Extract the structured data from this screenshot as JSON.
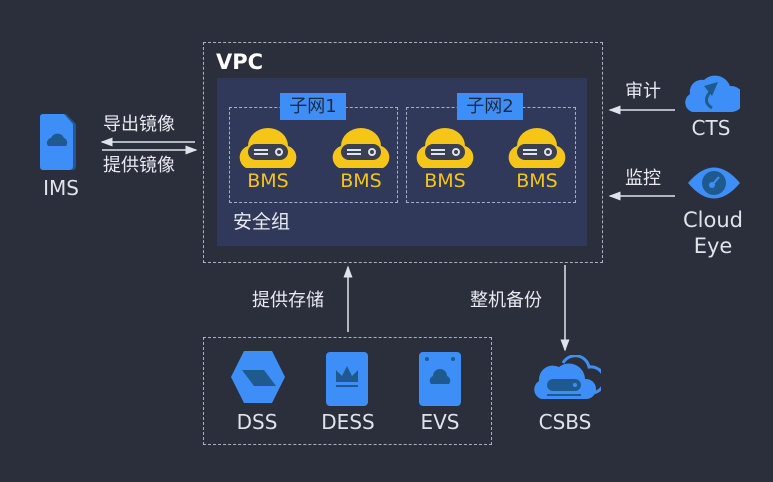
{
  "vpc": {
    "title": "VPC",
    "security_group": "安全组",
    "subnets": [
      {
        "label": "子网1",
        "servers": [
          "BMS",
          "BMS"
        ]
      },
      {
        "label": "子网2",
        "servers": [
          "BMS",
          "BMS"
        ]
      }
    ]
  },
  "ims": {
    "label": "IMS",
    "export_label": "导出镜像",
    "provide_label": "提供镜像"
  },
  "cts": {
    "label": "CTS",
    "edge_label": "审计"
  },
  "cloudeye": {
    "label_line1": "Cloud",
    "label_line2": "Eye",
    "edge_label": "监控"
  },
  "storage": {
    "edge_label": "提供存储",
    "items": [
      "DSS",
      "DESS",
      "EVS"
    ]
  },
  "csbs": {
    "label": "CSBS",
    "edge_label": "整机备份"
  },
  "colors": {
    "background": "#2b2e3b",
    "inner_box": "#30395a",
    "accent_blue": "#3e8ef7",
    "bms_yellow": "#f5c518"
  }
}
